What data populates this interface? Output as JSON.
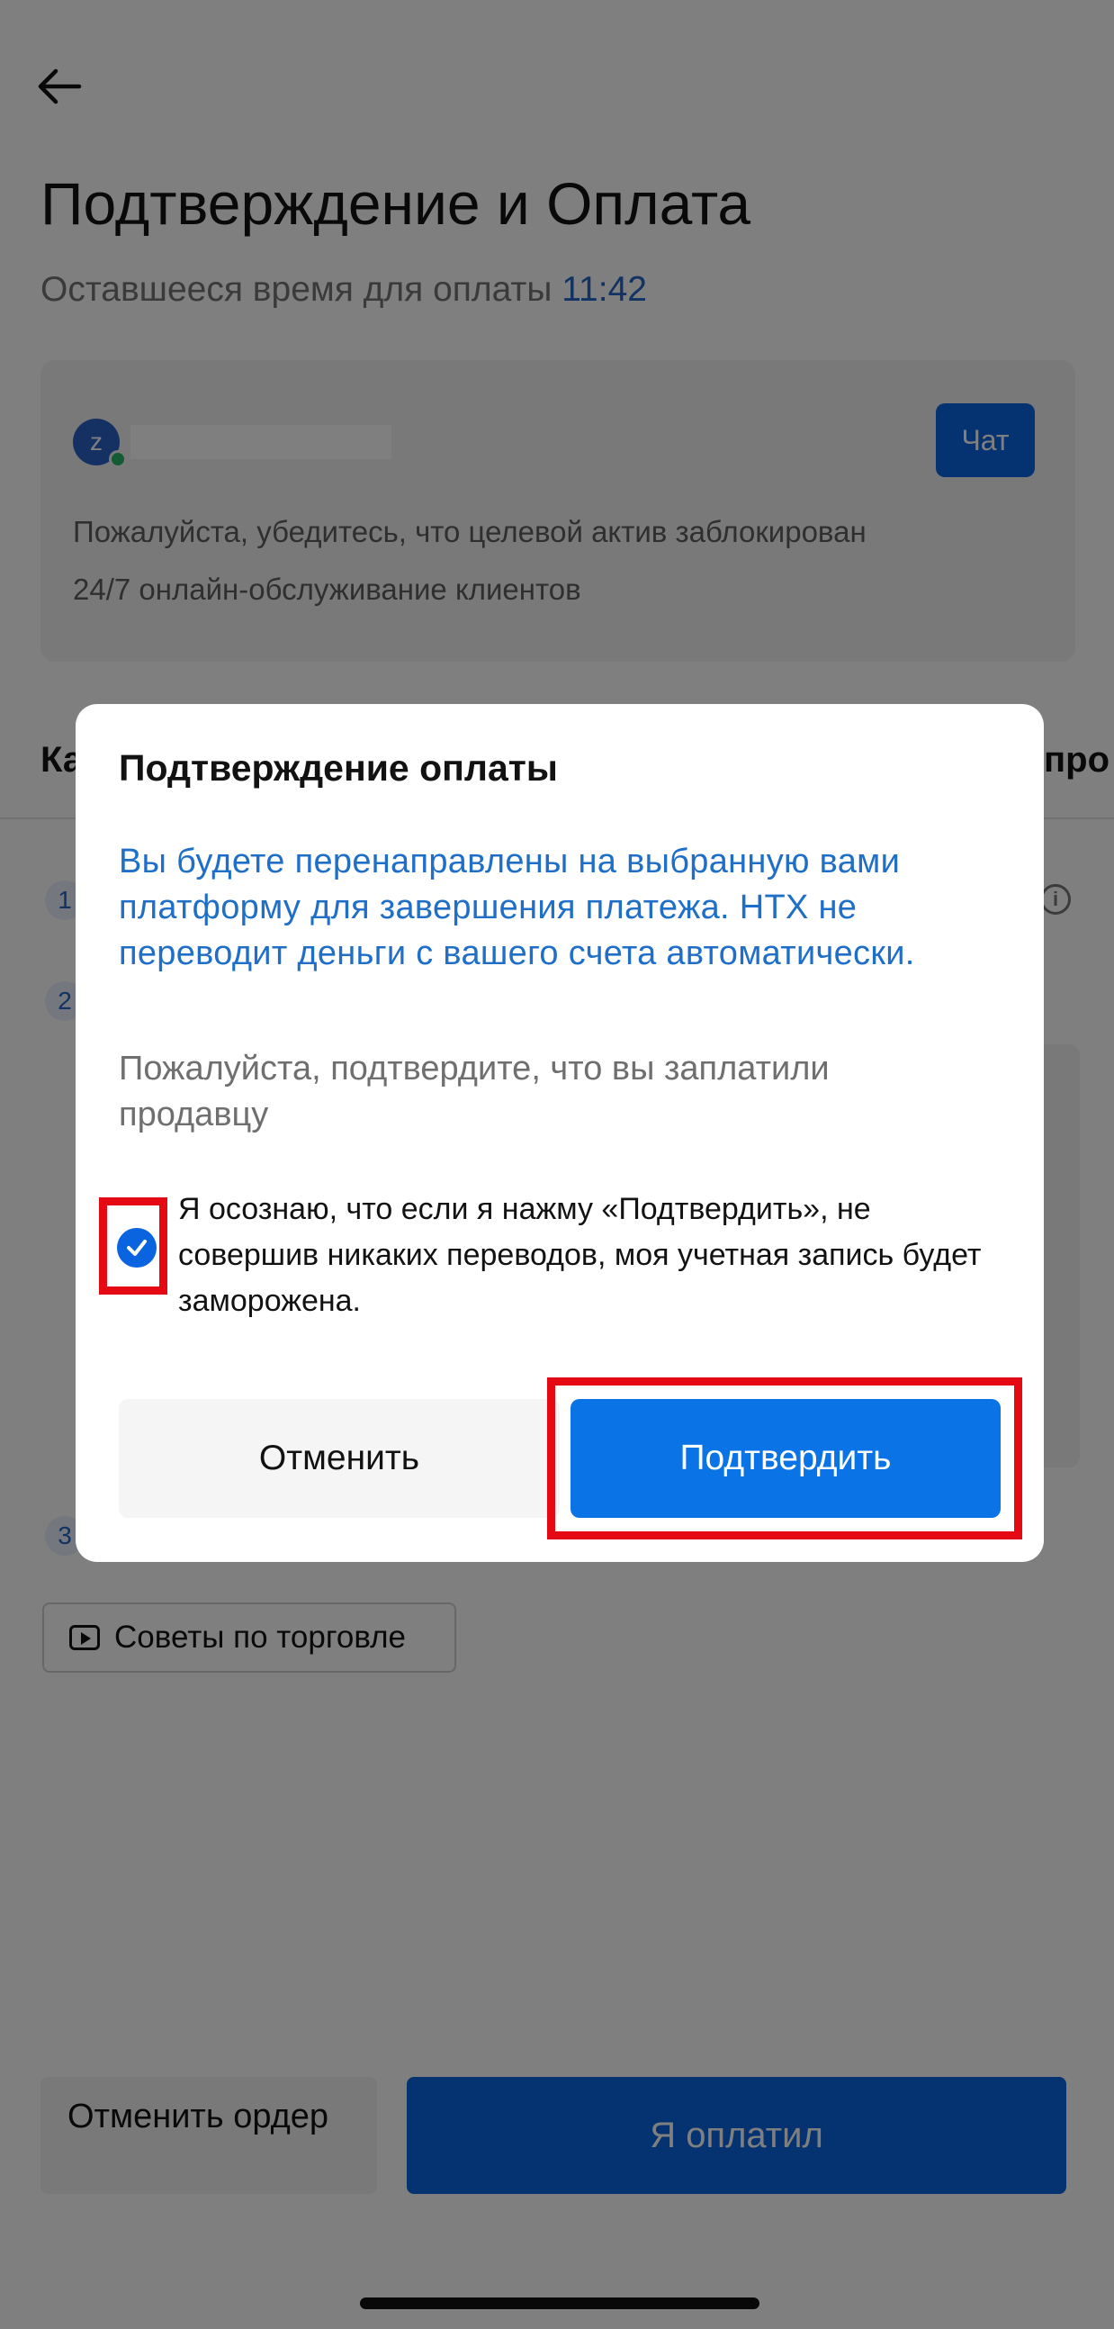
{
  "header": {
    "back_icon": "arrow-left-icon",
    "title": "Подтверждение и Оплата",
    "timer_label": "Оставшееся время для оплаты",
    "timer_value": "11:42"
  },
  "seller_card": {
    "avatar_letter": "z",
    "chat_label": "Чат",
    "line_1": "Пожалуйста, убедитесь, что целевой актив заблокирован",
    "line_2": "24/7 онлайн-обслуживание клиентов"
  },
  "background": {
    "tab_left": "Ка",
    "tab_right": "про",
    "steps": [
      "1",
      "2",
      "3"
    ],
    "tips_label": "Советы по торговле",
    "tips_icon": "video-play-icon",
    "info_icon": "info-icon"
  },
  "footer": {
    "cancel_order": "Отменить ордер",
    "paid": "Я оплатил"
  },
  "dialog": {
    "title": "Подтверждение оплаты",
    "notice": "Вы будете перенаправлены на выбранную вами платформу для завершения платежа. HTX не переводит деньги с вашего счета автоматически.",
    "prompt": "Пожалуйста, подтвердите, что вы заплатили продавцу",
    "acknowledgement": "Я осознаю, что если я нажму «Подтвердить», не совершив никаких переводов, моя учетная запись будет заморожена.",
    "checkbox_checked": true,
    "cancel": "Отменить",
    "confirm": "Подтвердить"
  },
  "colors": {
    "accent": "#0a64e0",
    "notice_text": "#1f6fc8",
    "highlight": "#e50914"
  }
}
